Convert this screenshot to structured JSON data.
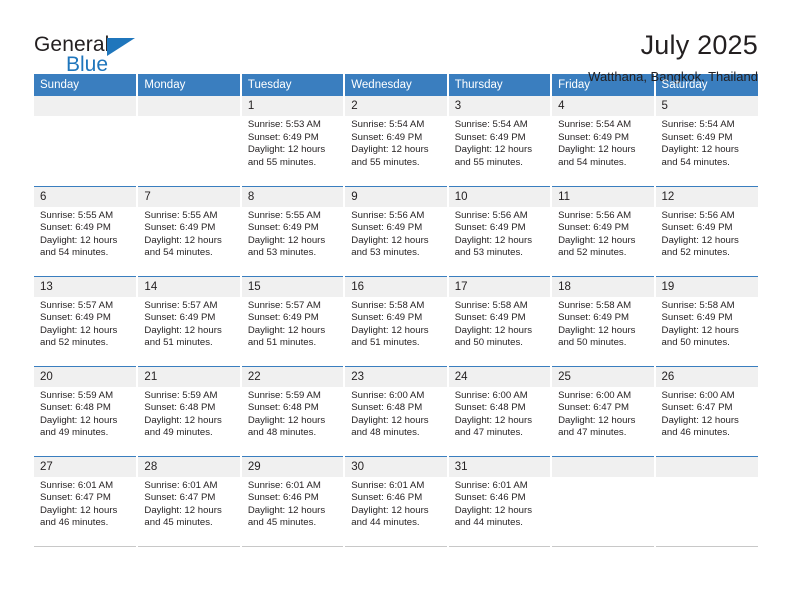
{
  "brand": {
    "line1": "General",
    "line2": "Blue",
    "icon": "triangle-logo"
  },
  "header": {
    "title": "July 2025",
    "subtitle": "Watthana, Bangkok, Thailand"
  },
  "weekday_headers": [
    "Sunday",
    "Monday",
    "Tuesday",
    "Wednesday",
    "Thursday",
    "Friday",
    "Saturday"
  ],
  "colors": {
    "header_blue": "#3a7ebf",
    "brand_blue": "#1f76bc",
    "daynum_band": "#f0f0f0",
    "text": "#231f20"
  },
  "weeks": [
    [
      {
        "day": "",
        "lines": []
      },
      {
        "day": "",
        "lines": []
      },
      {
        "day": "1",
        "lines": [
          "Sunrise: 5:53 AM",
          "Sunset: 6:49 PM",
          "Daylight: 12 hours",
          "and 55 minutes."
        ]
      },
      {
        "day": "2",
        "lines": [
          "Sunrise: 5:54 AM",
          "Sunset: 6:49 PM",
          "Daylight: 12 hours",
          "and 55 minutes."
        ]
      },
      {
        "day": "3",
        "lines": [
          "Sunrise: 5:54 AM",
          "Sunset: 6:49 PM",
          "Daylight: 12 hours",
          "and 55 minutes."
        ]
      },
      {
        "day": "4",
        "lines": [
          "Sunrise: 5:54 AM",
          "Sunset: 6:49 PM",
          "Daylight: 12 hours",
          "and 54 minutes."
        ]
      },
      {
        "day": "5",
        "lines": [
          "Sunrise: 5:54 AM",
          "Sunset: 6:49 PM",
          "Daylight: 12 hours",
          "and 54 minutes."
        ]
      }
    ],
    [
      {
        "day": "6",
        "lines": [
          "Sunrise: 5:55 AM",
          "Sunset: 6:49 PM",
          "Daylight: 12 hours",
          "and 54 minutes."
        ]
      },
      {
        "day": "7",
        "lines": [
          "Sunrise: 5:55 AM",
          "Sunset: 6:49 PM",
          "Daylight: 12 hours",
          "and 54 minutes."
        ]
      },
      {
        "day": "8",
        "lines": [
          "Sunrise: 5:55 AM",
          "Sunset: 6:49 PM",
          "Daylight: 12 hours",
          "and 53 minutes."
        ]
      },
      {
        "day": "9",
        "lines": [
          "Sunrise: 5:56 AM",
          "Sunset: 6:49 PM",
          "Daylight: 12 hours",
          "and 53 minutes."
        ]
      },
      {
        "day": "10",
        "lines": [
          "Sunrise: 5:56 AM",
          "Sunset: 6:49 PM",
          "Daylight: 12 hours",
          "and 53 minutes."
        ]
      },
      {
        "day": "11",
        "lines": [
          "Sunrise: 5:56 AM",
          "Sunset: 6:49 PM",
          "Daylight: 12 hours",
          "and 52 minutes."
        ]
      },
      {
        "day": "12",
        "lines": [
          "Sunrise: 5:56 AM",
          "Sunset: 6:49 PM",
          "Daylight: 12 hours",
          "and 52 minutes."
        ]
      }
    ],
    [
      {
        "day": "13",
        "lines": [
          "Sunrise: 5:57 AM",
          "Sunset: 6:49 PM",
          "Daylight: 12 hours",
          "and 52 minutes."
        ]
      },
      {
        "day": "14",
        "lines": [
          "Sunrise: 5:57 AM",
          "Sunset: 6:49 PM",
          "Daylight: 12 hours",
          "and 51 minutes."
        ]
      },
      {
        "day": "15",
        "lines": [
          "Sunrise: 5:57 AM",
          "Sunset: 6:49 PM",
          "Daylight: 12 hours",
          "and 51 minutes."
        ]
      },
      {
        "day": "16",
        "lines": [
          "Sunrise: 5:58 AM",
          "Sunset: 6:49 PM",
          "Daylight: 12 hours",
          "and 51 minutes."
        ]
      },
      {
        "day": "17",
        "lines": [
          "Sunrise: 5:58 AM",
          "Sunset: 6:49 PM",
          "Daylight: 12 hours",
          "and 50 minutes."
        ]
      },
      {
        "day": "18",
        "lines": [
          "Sunrise: 5:58 AM",
          "Sunset: 6:49 PM",
          "Daylight: 12 hours",
          "and 50 minutes."
        ]
      },
      {
        "day": "19",
        "lines": [
          "Sunrise: 5:58 AM",
          "Sunset: 6:49 PM",
          "Daylight: 12 hours",
          "and 50 minutes."
        ]
      }
    ],
    [
      {
        "day": "20",
        "lines": [
          "Sunrise: 5:59 AM",
          "Sunset: 6:48 PM",
          "Daylight: 12 hours",
          "and 49 minutes."
        ]
      },
      {
        "day": "21",
        "lines": [
          "Sunrise: 5:59 AM",
          "Sunset: 6:48 PM",
          "Daylight: 12 hours",
          "and 49 minutes."
        ]
      },
      {
        "day": "22",
        "lines": [
          "Sunrise: 5:59 AM",
          "Sunset: 6:48 PM",
          "Daylight: 12 hours",
          "and 48 minutes."
        ]
      },
      {
        "day": "23",
        "lines": [
          "Sunrise: 6:00 AM",
          "Sunset: 6:48 PM",
          "Daylight: 12 hours",
          "and 48 minutes."
        ]
      },
      {
        "day": "24",
        "lines": [
          "Sunrise: 6:00 AM",
          "Sunset: 6:48 PM",
          "Daylight: 12 hours",
          "and 47 minutes."
        ]
      },
      {
        "day": "25",
        "lines": [
          "Sunrise: 6:00 AM",
          "Sunset: 6:47 PM",
          "Daylight: 12 hours",
          "and 47 minutes."
        ]
      },
      {
        "day": "26",
        "lines": [
          "Sunrise: 6:00 AM",
          "Sunset: 6:47 PM",
          "Daylight: 12 hours",
          "and 46 minutes."
        ]
      }
    ],
    [
      {
        "day": "27",
        "lines": [
          "Sunrise: 6:01 AM",
          "Sunset: 6:47 PM",
          "Daylight: 12 hours",
          "and 46 minutes."
        ]
      },
      {
        "day": "28",
        "lines": [
          "Sunrise: 6:01 AM",
          "Sunset: 6:47 PM",
          "Daylight: 12 hours",
          "and 45 minutes."
        ]
      },
      {
        "day": "29",
        "lines": [
          "Sunrise: 6:01 AM",
          "Sunset: 6:46 PM",
          "Daylight: 12 hours",
          "and 45 minutes."
        ]
      },
      {
        "day": "30",
        "lines": [
          "Sunrise: 6:01 AM",
          "Sunset: 6:46 PM",
          "Daylight: 12 hours",
          "and 44 minutes."
        ]
      },
      {
        "day": "31",
        "lines": [
          "Sunrise: 6:01 AM",
          "Sunset: 6:46 PM",
          "Daylight: 12 hours",
          "and 44 minutes."
        ]
      },
      {
        "day": "",
        "lines": []
      },
      {
        "day": "",
        "lines": []
      }
    ]
  ]
}
